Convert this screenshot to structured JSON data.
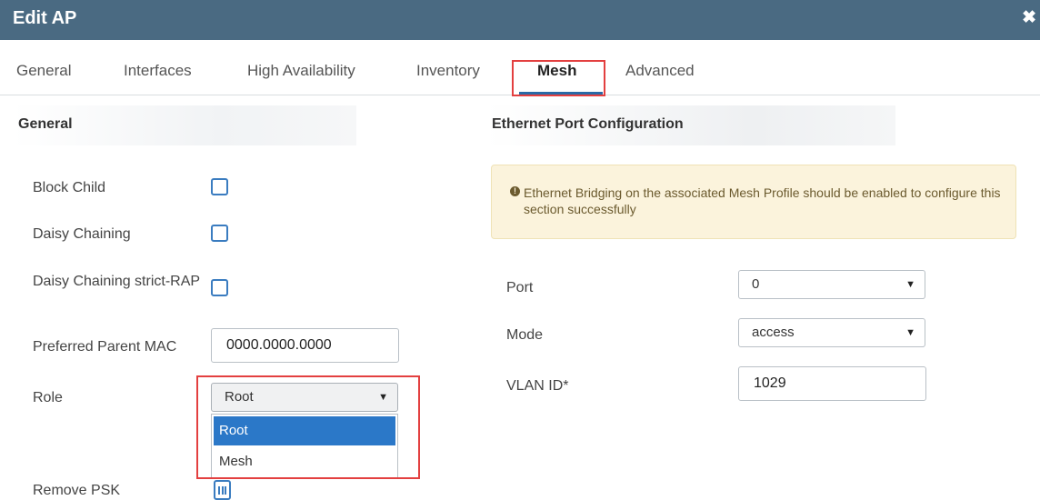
{
  "window": {
    "title": "Edit AP",
    "close_glyph": "✖"
  },
  "tabs": [
    {
      "label": "General"
    },
    {
      "label": "Interfaces"
    },
    {
      "label": "High Availability"
    },
    {
      "label": "Inventory"
    },
    {
      "label": "Mesh",
      "active": true
    },
    {
      "label": "Advanced"
    }
  ],
  "general": {
    "header": "General",
    "block_child": {
      "label": "Block Child",
      "checked": false
    },
    "daisy_chaining": {
      "label": "Daisy Chaining",
      "checked": false
    },
    "daisy_chaining_strict": {
      "label": "Daisy Chaining strict-RAP",
      "checked": false
    },
    "preferred_parent_mac": {
      "label": "Preferred Parent MAC",
      "value": "0000.0000.0000"
    },
    "role": {
      "label": "Role",
      "selected": "Root",
      "options": [
        "Root",
        "Mesh"
      ]
    },
    "remove_psk": {
      "label": "Remove PSK"
    }
  },
  "ethernet": {
    "header": "Ethernet Port Configuration",
    "alert": {
      "icon": "info-icon",
      "text": "Ethernet Bridging on the associated Mesh Profile should be enabled to configure this section successfully"
    },
    "port": {
      "label": "Port",
      "value": "0"
    },
    "mode": {
      "label": "Mode",
      "value": "access"
    },
    "vlan_id": {
      "label": "VLAN ID*",
      "value": "1029"
    }
  },
  "colors": {
    "titlebar": "#4a6a82",
    "accent": "#2b6aa6",
    "highlight": "#e34040",
    "alert_bg": "#fbf3dc"
  }
}
